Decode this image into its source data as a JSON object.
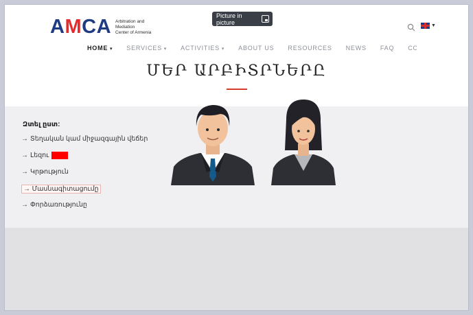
{
  "logo": {
    "word_prefix": "A",
    "word_mid": "M",
    "word_suffix": "CA",
    "subtitle_lines": [
      "Arbitration and",
      "Mediation",
      "Center of Armenia"
    ]
  },
  "pip_overlay": {
    "label": "Picture in picture"
  },
  "header": {
    "nav": [
      {
        "label": "HOME",
        "dropdown": true,
        "active": true
      },
      {
        "label": "SERVICES",
        "dropdown": true,
        "active": false
      },
      {
        "label": "ACTIVITIES",
        "dropdown": true,
        "active": false
      },
      {
        "label": "ABOUT US",
        "dropdown": false,
        "active": false
      },
      {
        "label": "RESOURCES",
        "dropdown": false,
        "active": false
      },
      {
        "label": "NEWS",
        "dropdown": false,
        "active": false
      },
      {
        "label": "FAQ",
        "dropdown": false,
        "active": false
      },
      {
        "label": "CONTACT US",
        "dropdown": false,
        "active": false
      }
    ],
    "language_icon": "uk-flag-icon"
  },
  "page_title": "ՄԵՐ ԱՐԲԻՏՐՆԵՐԸ",
  "filter": {
    "heading": "Զտել ըստ:",
    "items": [
      "Տեղական կամ միջազգային վեճեր",
      "Լեզու",
      "Կրթություն",
      "Մասնագիտացումը",
      "Փորձառությունը"
    ]
  },
  "colors": {
    "brand_blue": "#1f3b82",
    "brand_red": "#e52b2b",
    "accent_red": "#d63a2a",
    "redaction": "#ff0000"
  }
}
